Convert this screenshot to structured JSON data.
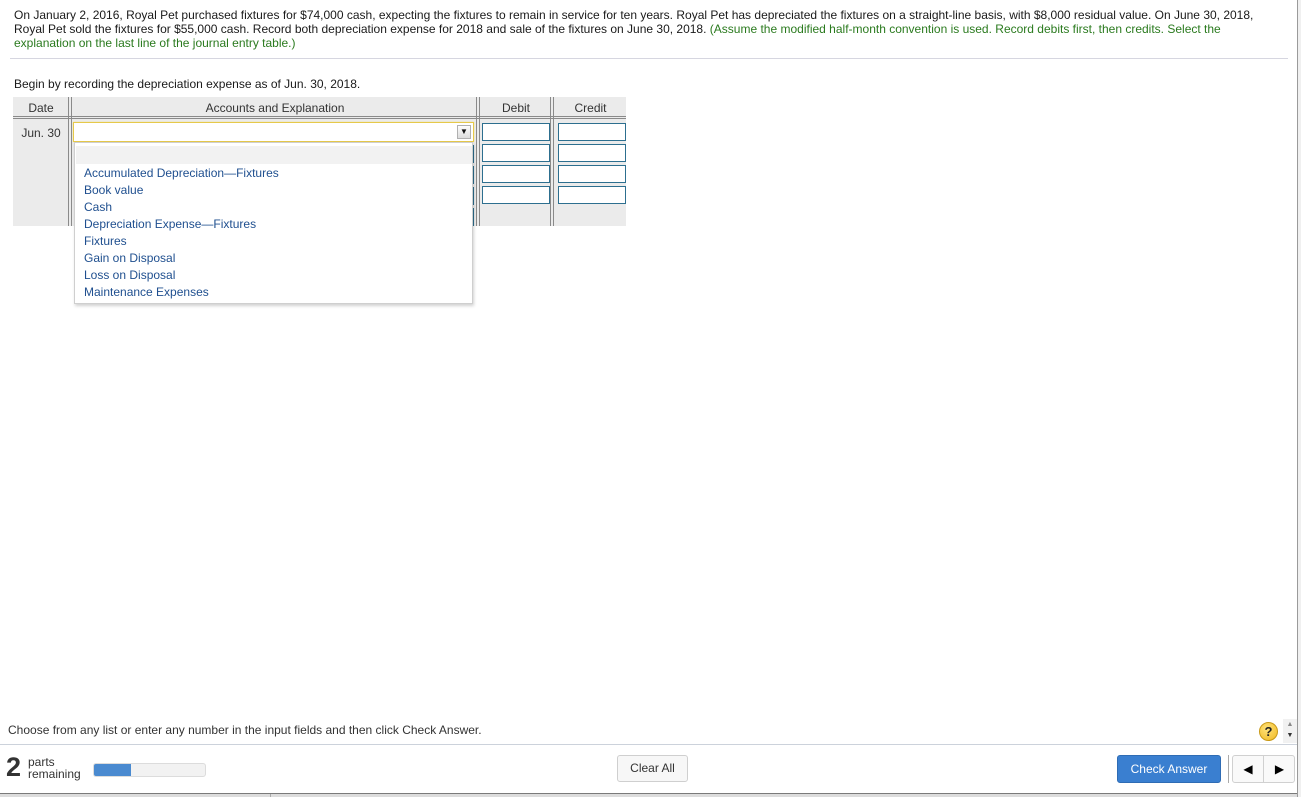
{
  "question": {
    "text": "On January 2, 2016, Royal Pet purchased fixtures for $74,000 cash, expecting the fixtures to remain in service for ten years. Royal Pet has depreciated the fixtures on a straight-line basis, with $8,000 residual value. On June 30, 2018, Royal Pet sold the fixtures for $55,000 cash. Record both depreciation expense for 2018 and sale of the fixtures on June 30, 2018.",
    "instruction": "(Assume the modified half-month convention is used. Record debits first, then credits. Select the explanation on the last line of the journal entry table.)"
  },
  "prompt": "Begin by recording the depreciation expense as of Jun. 30, 2018.",
  "journal": {
    "headers": {
      "date": "Date",
      "accounts": "Accounts and Explanation",
      "debit": "Debit",
      "credit": "Credit"
    },
    "date": "Jun. 30",
    "account_selected": "",
    "dropdown_arrow": "▼"
  },
  "dropdown": {
    "options": [
      "Accumulated Depreciation—Fixtures",
      "Book value",
      "Cash",
      "Depreciation Expense—Fixtures",
      "Fixtures",
      "Gain on Disposal",
      "Loss on Disposal",
      "Maintenance Expenses"
    ]
  },
  "footer": {
    "hint": "Choose from any list or enter any number in the input fields and then click Check Answer.",
    "help_icon": "?",
    "parts_count": "2",
    "parts_label_1": "parts",
    "parts_label_2": "remaining",
    "progress_percent": 33,
    "clear_all": "Clear All",
    "check_answer": "Check Answer",
    "prev_icon": "◀",
    "next_icon": "▶",
    "scroll_up": "▲",
    "scroll_down": "▼"
  },
  "colors": {
    "instruction_green": "#2a7a1e",
    "link_blue": "#1f4f8f",
    "primary_button": "#3a7fd0",
    "progress_fill": "#4a8ad0"
  }
}
